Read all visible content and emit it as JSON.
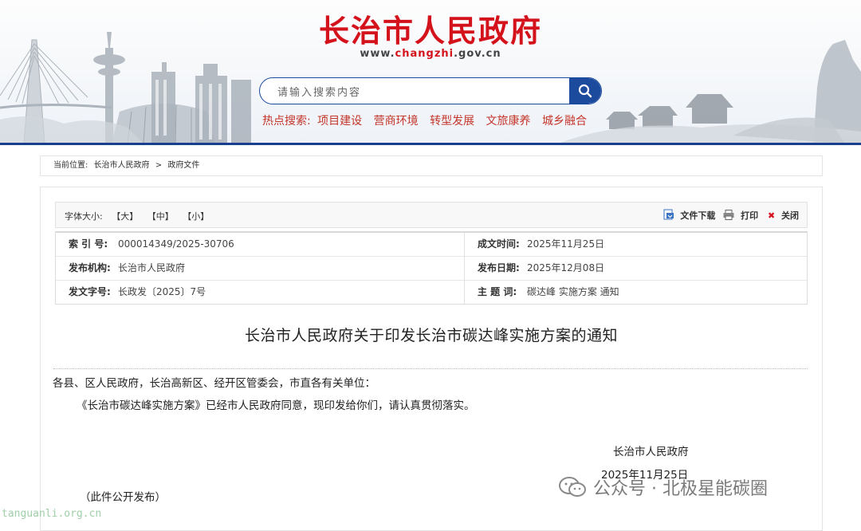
{
  "header": {
    "site_title": "长治市人民政府",
    "url_prefix": "www.",
    "url_highlight": "changzhi",
    "url_suffix": ".gov.cn",
    "search_placeholder": "请输入搜索内容",
    "hot_label": "热点搜索:",
    "hot_links": [
      "项目建设",
      "营商环境",
      "转型发展",
      "文旅康养",
      "城乡融合"
    ]
  },
  "breadcrumb": {
    "label": "当前位置:",
    "items": [
      "长治市人民政府",
      ">",
      "政府文件"
    ]
  },
  "toolbar": {
    "font_size_label": "字体大小:",
    "large": "【大】",
    "medium": "【中】",
    "small": "【小】",
    "download": "文件下载",
    "print": "打印",
    "close": "关闭"
  },
  "meta": {
    "index_label": "索 引 号:",
    "index_value": "000014349/2025-30706",
    "created_label": "成文时间:",
    "created_value": "2025年11月25日",
    "issuer_label": "发布机构:",
    "issuer_value": "长治市人民政府",
    "publish_label": "发布日期:",
    "publish_value": "2025年12月08日",
    "docno_label": "发文字号:",
    "docno_value": "长政发〔2025〕7号",
    "subject_label": "主 题 词:",
    "subject_value": "碳达峰 实施方案 通知"
  },
  "document": {
    "title": "长治市人民政府关于印发长治市碳达峰实施方案的通知",
    "salutation": "各县、区人民政府，长治高新区、经开区管委会，市直各有关单位：",
    "body": "《长治市碳达峰实施方案》已经市人民政府同意，现印发给你们，请认真贯彻落实。",
    "signer": "长治市人民政府",
    "date": "2025年11月25日",
    "note": "（此件公开发布）"
  },
  "watermarks": {
    "site": "tanguanli.org.cn",
    "account": "公众号 · 北极星能碳圈"
  },
  "colors": {
    "title_red": "#d4121c",
    "nav_blue": "#1b3f8f",
    "hot_red": "#c4352a"
  }
}
